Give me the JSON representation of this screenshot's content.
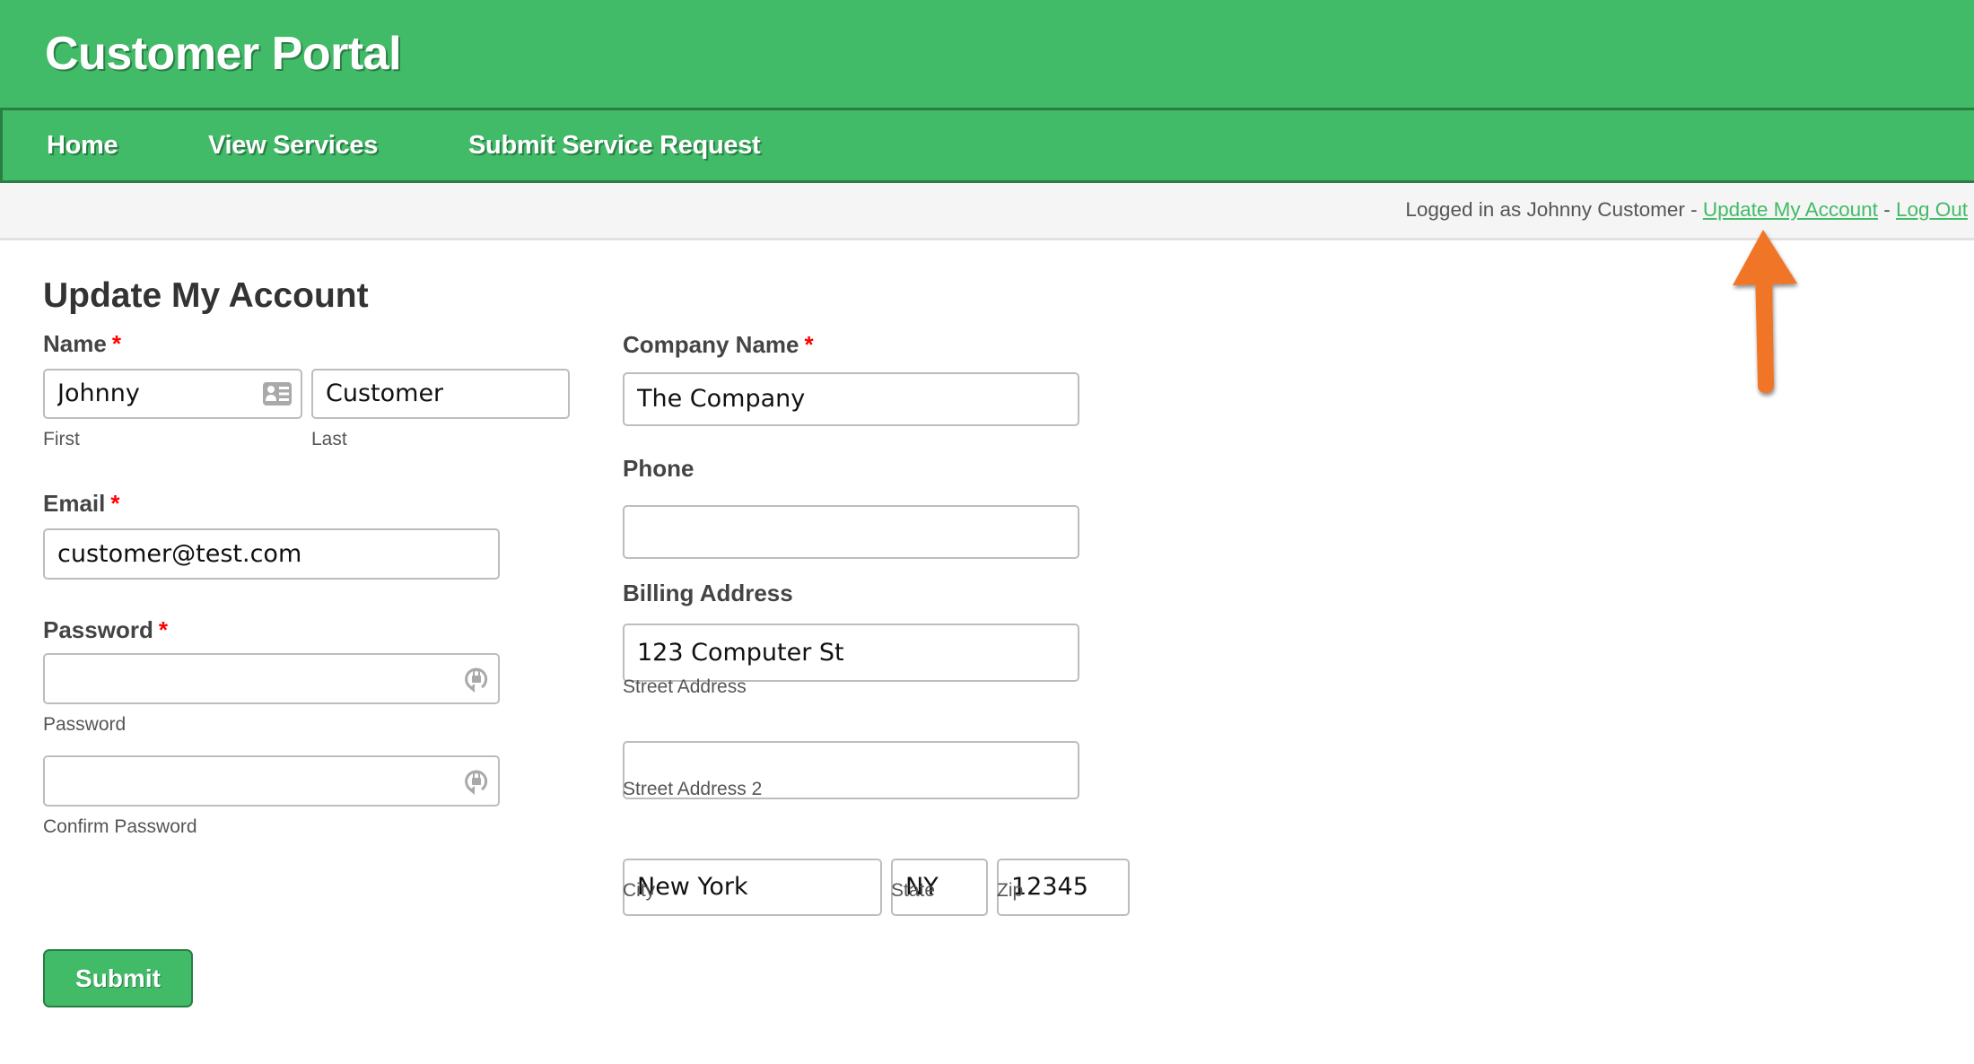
{
  "header": {
    "title": "Customer Portal"
  },
  "nav": {
    "items": [
      {
        "label": "Home"
      },
      {
        "label": "View Services"
      },
      {
        "label": "Submit Service Request"
      }
    ]
  },
  "user_bar": {
    "prefix": "Logged in as Johnny Customer - ",
    "update_link": "Update My Account",
    "separator": " - ",
    "logout_link": "Log Out"
  },
  "page": {
    "heading": "Update My Account"
  },
  "form": {
    "required_marker": "*",
    "name": {
      "label": "Name",
      "first_value": "Johnny",
      "first_sublabel": "First",
      "last_value": "Customer",
      "last_sublabel": "Last",
      "first_icon": "contact-card-icon"
    },
    "email": {
      "label": "Email",
      "value": "customer@test.com"
    },
    "password": {
      "label": "Password",
      "value": "",
      "sublabel": "Password",
      "confirm_value": "",
      "confirm_sublabel": "Confirm Password",
      "icon": "password-manager-lock-icon"
    },
    "company": {
      "label": "Company Name",
      "value": "The Company"
    },
    "phone": {
      "label": "Phone",
      "value": ""
    },
    "billing": {
      "label": "Billing Address",
      "street1_value": "123 Computer St",
      "street1_sublabel": "Street Address",
      "street2_value": "",
      "street2_sublabel": "Street Address 2",
      "city_value": "New York",
      "city_sublabel": "City",
      "state_value": "NY",
      "state_sublabel": "State",
      "zip_value": "12345",
      "zip_sublabel": "Zip"
    },
    "submit_label": "Submit"
  },
  "colors": {
    "brand_green": "#41bb67",
    "brand_green_dark": "#2a7d45",
    "required_red": "#ff0000",
    "annotation_orange": "#f07427"
  }
}
